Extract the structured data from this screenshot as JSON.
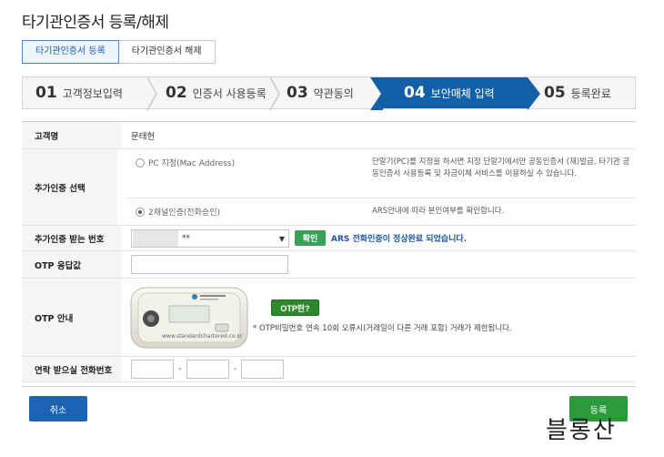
{
  "page": {
    "title": "타기관인증서 등록/해제"
  },
  "tabs": [
    {
      "label": "타기관인증서 등록",
      "active": true
    },
    {
      "label": "타기관인증서 해제",
      "active": false
    }
  ],
  "steps": [
    {
      "num": "01",
      "label": "고객정보입력"
    },
    {
      "num": "02",
      "label": "인증서 사용등록"
    },
    {
      "num": "03",
      "label": "약관동의"
    },
    {
      "num": "04",
      "label": "보안매체 입력",
      "active": true
    },
    {
      "num": "05",
      "label": "등록완료"
    }
  ],
  "form": {
    "name_label": "고객명",
    "name_value": "문태헌",
    "auth_label": "추가인증 선택",
    "auth_options": [
      {
        "label": "PC 지정(Mac Address)",
        "checked": false,
        "desc": "단말기(PC)를 지정을 하시면 지정 단말기에서만 공동인증서 (재)발급, 타기관 공동인증서 사용등록 및 자금이체 서비스를 이용하실 수 있습니다."
      },
      {
        "label": "2채널인증(전화승인)",
        "checked": true,
        "desc": "ARS안내에 따라 본인여부를 확인합니다."
      }
    ],
    "phone_label": "추가인증 받는 번호",
    "phone_select_value": "**",
    "confirm_label": "확인",
    "ars_message": "ARS 전화인증이 정상완료 되었습니다.",
    "otp_label": "OTP 응답값",
    "otp_placeholder": "",
    "guide_label": "OTP 안내",
    "otp_button_label": "OTP란?",
    "otp_note": "* OTP비밀번호 연속 10회 오류시(거래일이 다른 거래 포함) 거래가 제한됩니다.",
    "device_url": "www.standardchartered.co.kr",
    "contact_label": "연락 받으실 전화번호",
    "dash": "-"
  },
  "actions": {
    "cancel_label": "취소",
    "register_label": "등록"
  },
  "watermark": "블롱산",
  "colors": {
    "active_step": "#1360a8",
    "confirm_green": "#3aa257",
    "cancel_blue": "#1d63b3",
    "register_green": "#2b9a3b"
  }
}
